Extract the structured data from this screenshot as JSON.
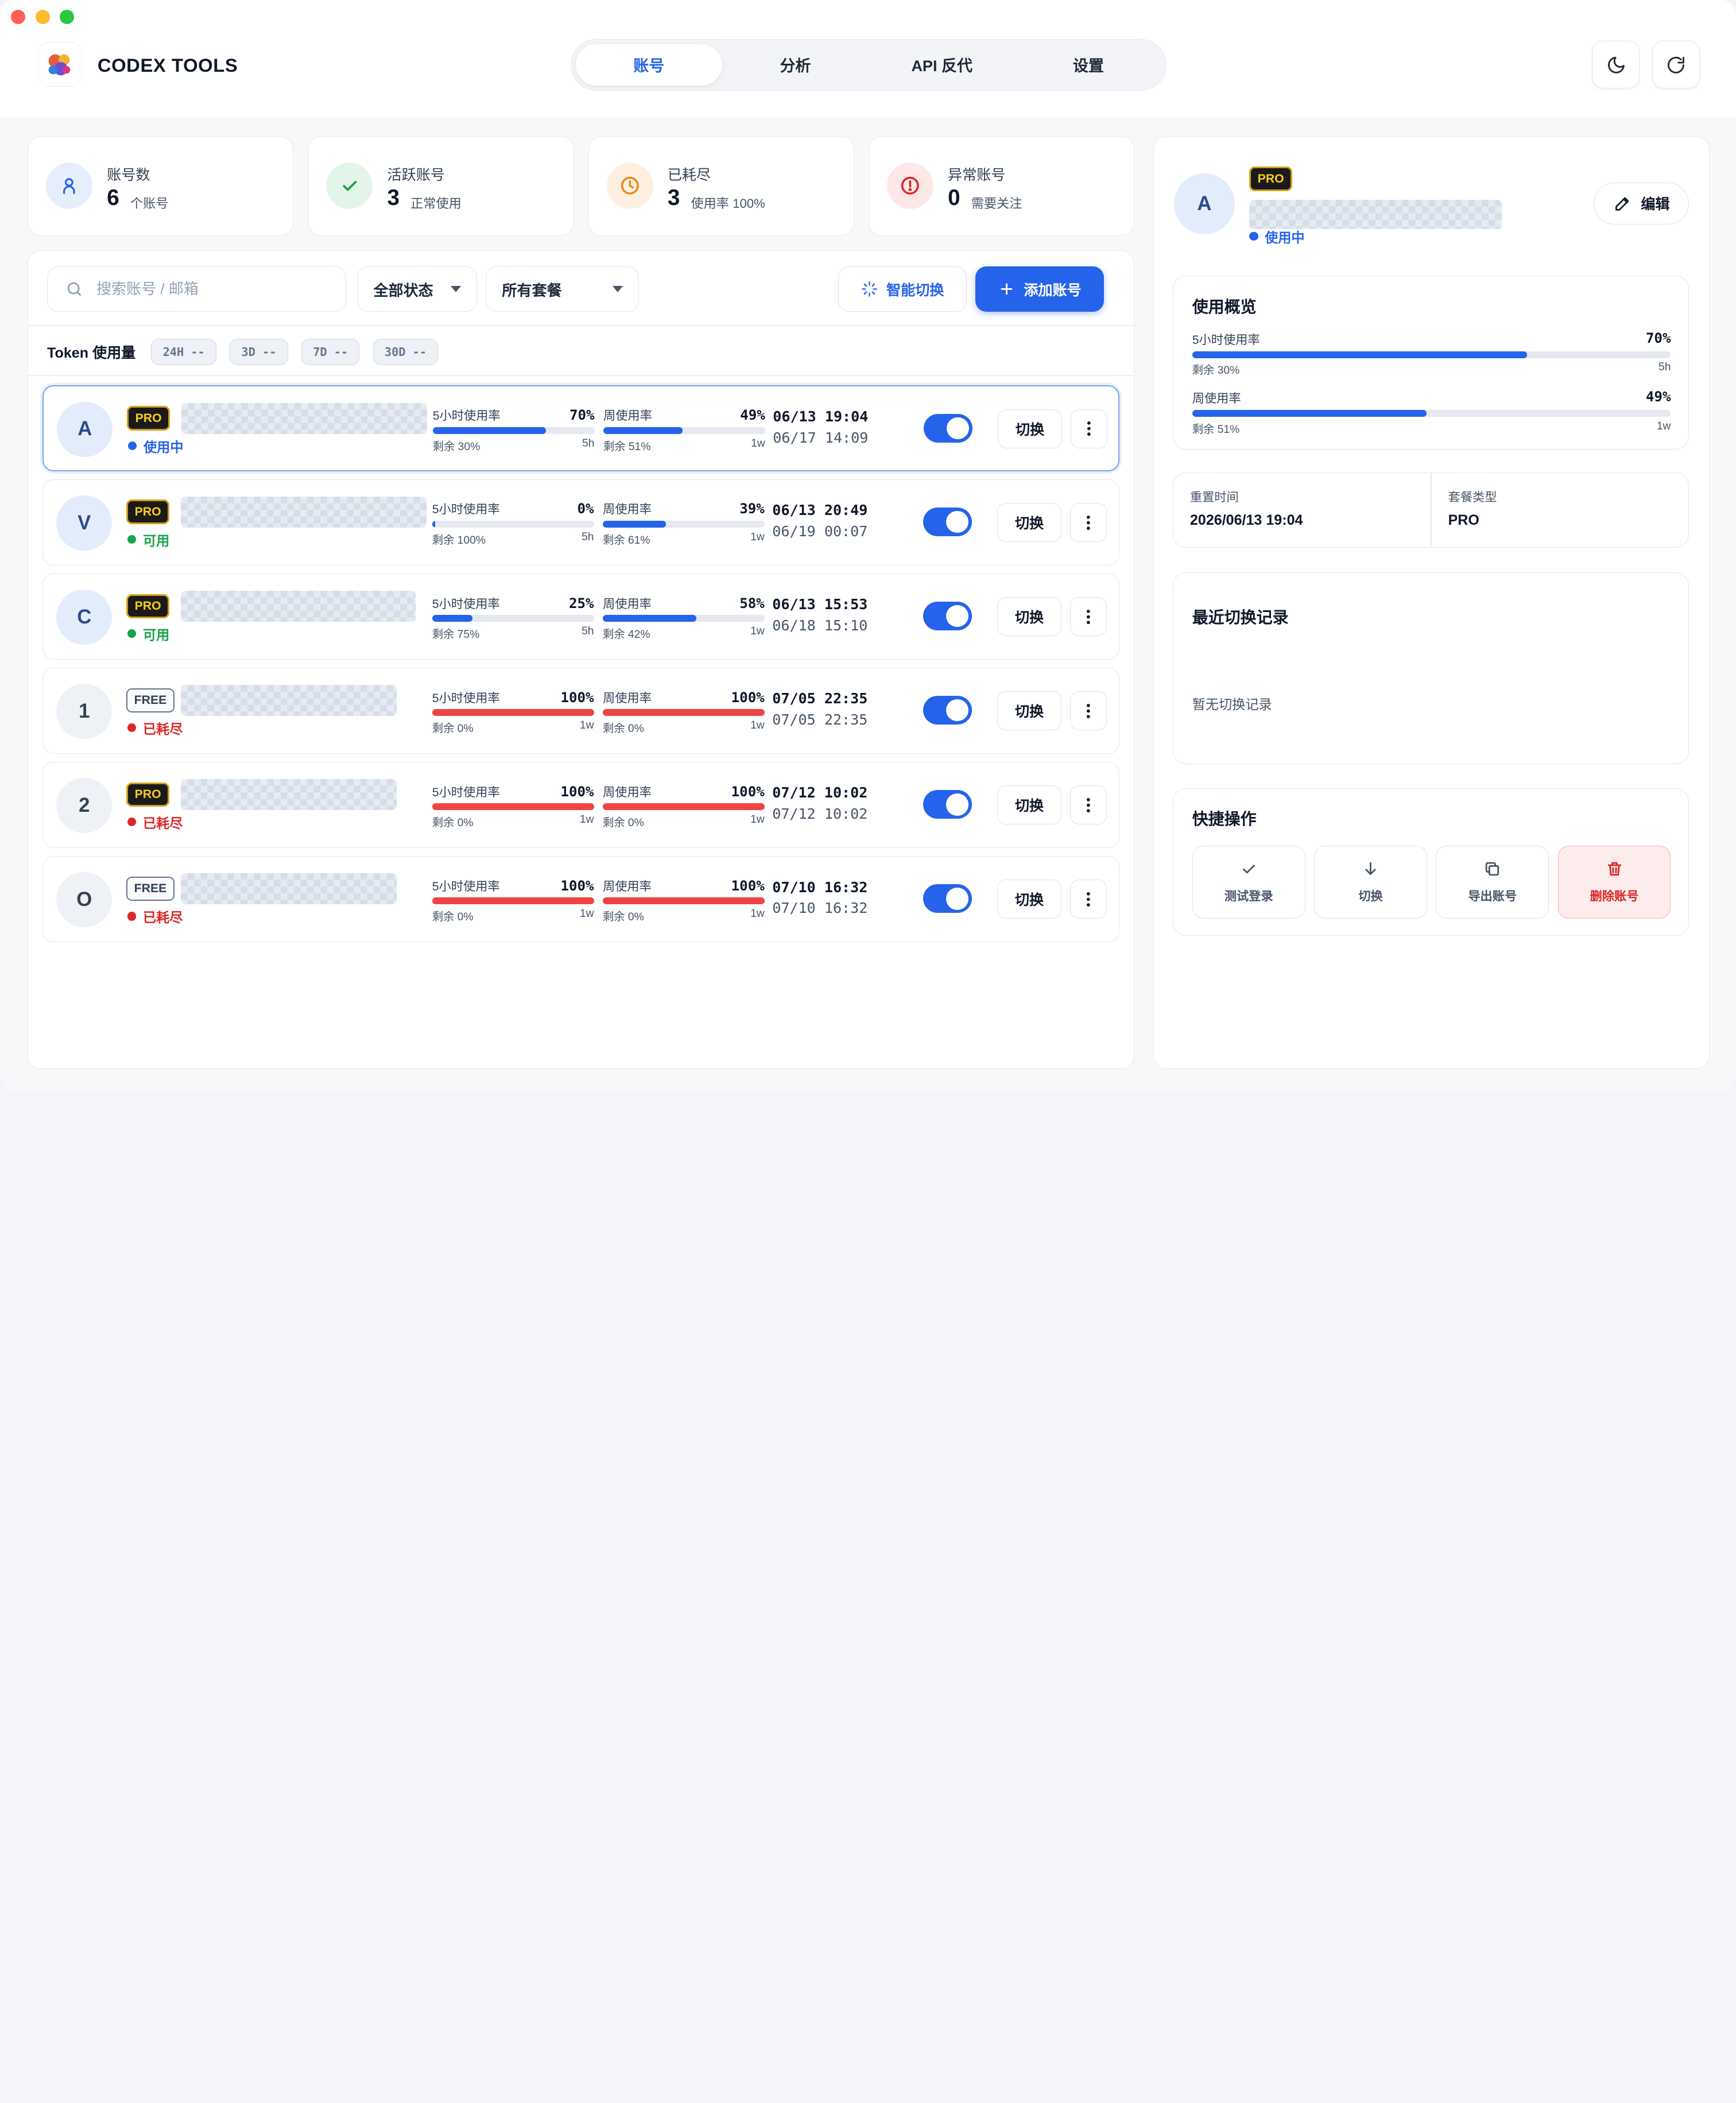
{
  "app": {
    "title": "CODEX TOOLS"
  },
  "nav": {
    "tabs": [
      "账号",
      "分析",
      "API 反代",
      "设置"
    ],
    "active": 0
  },
  "stats": [
    {
      "label": "账号数",
      "value": "6",
      "unit": "个账号",
      "color": "#2563eb"
    },
    {
      "label": "活跃账号",
      "value": "3",
      "unit": "正常使用",
      "color": "#16a34a"
    },
    {
      "label": "已耗尽",
      "value": "3",
      "unit": "使用率 100%",
      "color": "#ea8a16"
    },
    {
      "label": "异常账号",
      "value": "0",
      "unit": "需要关注",
      "color": "#dc2626"
    }
  ],
  "toolbar": {
    "search_placeholder": "搜索账号 / 邮箱",
    "status_filter": "全部状态",
    "plan_filter": "所有套餐",
    "smart_switch": "智能切换",
    "add_account": "添加账号"
  },
  "token": {
    "label": "Token 使用量",
    "chips": [
      "24H --",
      "3D --",
      "7D --",
      "30D --"
    ]
  },
  "labels": {
    "five_hour": "5小时使用率",
    "weekly": "周使用率",
    "switch": "切换"
  },
  "accounts": [
    {
      "initial": "A",
      "plan": "PRO",
      "status": "使用中",
      "status_color": "#2563eb",
      "h5_pct": "70%",
      "h5_fill": 70,
      "h5_remain": "剩余 30%",
      "h5_window": "5h",
      "wk_pct": "49%",
      "wk_fill": 49,
      "wk_remain": "剩余 51%",
      "wk_window": "1w",
      "time1": "06/13 19:04",
      "time2": "06/17 14:09",
      "enabled": true,
      "selected": true
    },
    {
      "initial": "V",
      "plan": "PRO",
      "status": "可用",
      "status_color": "#16a34a",
      "h5_pct": "0%",
      "h5_fill": 0,
      "h5_remain": "剩余 100%",
      "h5_window": "5h",
      "wk_pct": "39%",
      "wk_fill": 39,
      "wk_remain": "剩余 61%",
      "wk_window": "1w",
      "time1": "06/13 20:49",
      "time2": "06/19 00:07",
      "enabled": true,
      "selected": false
    },
    {
      "initial": "C",
      "plan": "PRO",
      "status": "可用",
      "status_color": "#16a34a",
      "h5_pct": "25%",
      "h5_fill": 25,
      "h5_remain": "剩余 75%",
      "h5_window": "5h",
      "wk_pct": "58%",
      "wk_fill": 58,
      "wk_remain": "剩余 42%",
      "wk_window": "1w",
      "time1": "06/13 15:53",
      "time2": "06/18 15:10",
      "enabled": true,
      "selected": false
    },
    {
      "initial": "1",
      "plan": "FREE",
      "status": "已耗尽",
      "status_color": "#dc2626",
      "h5_pct": "100%",
      "h5_fill": 100,
      "h5_remain": "剩余 0%",
      "h5_window": "1w",
      "wk_pct": "100%",
      "wk_fill": 100,
      "wk_remain": "剩余 0%",
      "wk_window": "1w",
      "time1": "07/05 22:35",
      "time2": "07/05 22:35",
      "enabled": true,
      "selected": false
    },
    {
      "initial": "2",
      "plan": "PRO",
      "status": "已耗尽",
      "status_color": "#dc2626",
      "h5_pct": "100%",
      "h5_fill": 100,
      "h5_remain": "剩余 0%",
      "h5_window": "1w",
      "wk_pct": "100%",
      "wk_fill": 100,
      "wk_remain": "剩余 0%",
      "wk_window": "1w",
      "time1": "07/12 10:02",
      "time2": "07/12 10:02",
      "enabled": true,
      "selected": false
    },
    {
      "initial": "O",
      "plan": "FREE",
      "status": "已耗尽",
      "status_color": "#dc2626",
      "h5_pct": "100%",
      "h5_fill": 100,
      "h5_remain": "剩余 0%",
      "h5_window": "1w",
      "wk_pct": "100%",
      "wk_fill": 100,
      "wk_remain": "剩余 0%",
      "wk_window": "1w",
      "time1": "07/10 16:32",
      "time2": "07/10 16:32",
      "enabled": true,
      "selected": false
    }
  ],
  "detail": {
    "initial": "A",
    "plan": "PRO",
    "status": "使用中",
    "edit": "编辑",
    "usage_title": "使用概览",
    "h5_label": "5小时使用率",
    "h5_pct": "70%",
    "h5_fill": 70,
    "h5_remain": "剩余 30%",
    "h5_window": "5h",
    "wk_label": "周使用率",
    "wk_pct": "49%",
    "wk_fill": 49,
    "wk_remain": "剩余 51%",
    "wk_window": "1w",
    "reset_label": "重置时间",
    "reset_value": "2026/06/13 19:04",
    "plan_label": "套餐类型",
    "plan_value": "PRO",
    "history_title": "最近切换记录",
    "history_empty": "暂无切换记录",
    "quick_title": "快捷操作",
    "quick": [
      "测试登录",
      "切换",
      "导出账号",
      "删除账号"
    ]
  },
  "colors": {
    "accent": "#2563eb",
    "danger": "#ef4444",
    "success": "#16a34a",
    "warning": "#ea8a16"
  }
}
